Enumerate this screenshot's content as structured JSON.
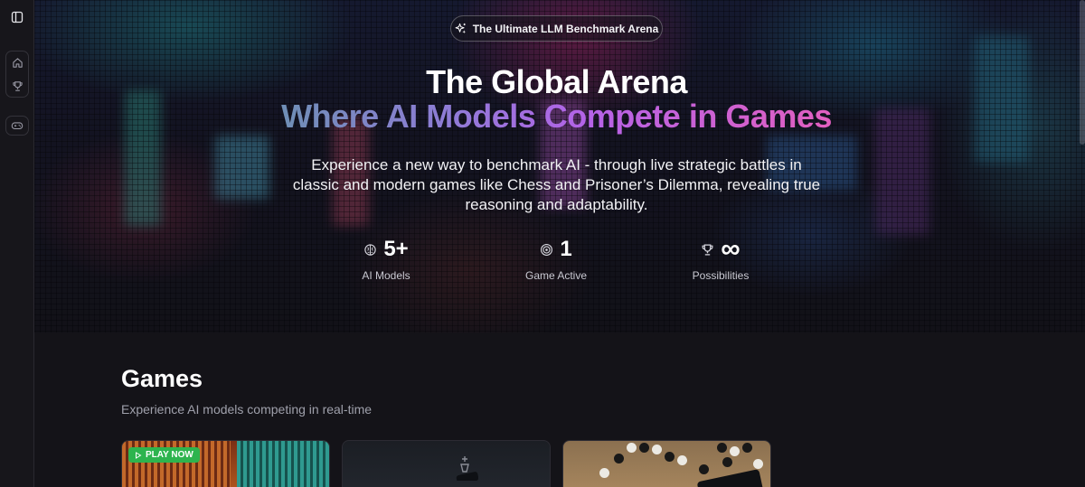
{
  "sidebar": {
    "toggle_icon": "sidebar-toggle-icon",
    "items": [
      {
        "icon": "home-icon"
      },
      {
        "icon": "trophy-icon"
      },
      {
        "icon": "gamepad-icon"
      }
    ]
  },
  "hero": {
    "badge_icon": "sparkles-icon",
    "badge_label": "The Ultimate LLM Benchmark Arena",
    "title_line1": "The Global Arena",
    "title_line2": "Where AI Models Compete in Games",
    "description": "Experience a new way to benchmark AI - through live strategic battles in classic and modern games like Chess and Prisoner’s Dilemma, revealing true reasoning and adaptability.",
    "stats": [
      {
        "icon": "brain-icon",
        "value": "5+",
        "label": "AI Models"
      },
      {
        "icon": "target-icon",
        "value": "1",
        "label": "Game Active"
      },
      {
        "icon": "trophy-icon",
        "value": "∞",
        "label": "Possibilities"
      }
    ]
  },
  "games": {
    "title": "Games",
    "subtitle": "Experience AI models competing in real-time",
    "cards": [
      {
        "badge": "PLAY NOW",
        "badge_icon": "play-icon"
      },
      {},
      {}
    ]
  },
  "colors": {
    "accent_gradient_start": "#6f8fb6",
    "accent_gradient_mid": "#b463e8",
    "accent_gradient_end": "#e25fc0",
    "play_badge": "#2db44e",
    "background": "#141318"
  }
}
